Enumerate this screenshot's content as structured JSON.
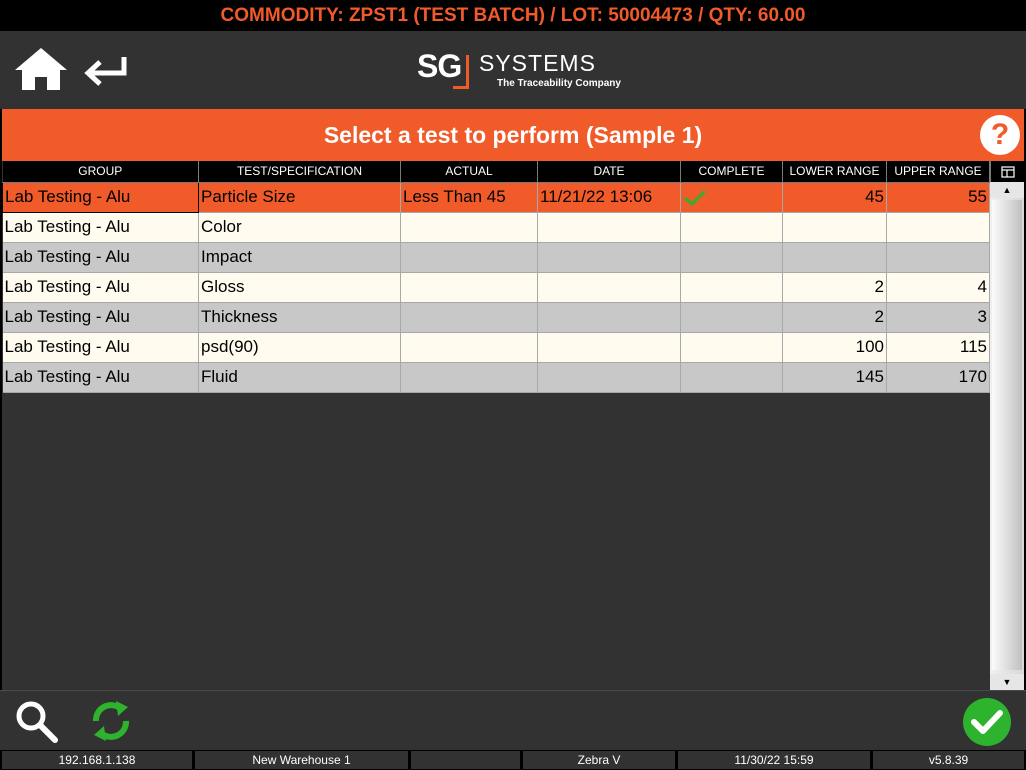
{
  "top_bar": {
    "text": "COMMODITY: ZPST1 (TEST BATCH) / LOT: 50004473 / QTY: 60.00"
  },
  "logo": {
    "sg": "SG",
    "systems": "SYSTEMS",
    "tagline": "The Traceability Company"
  },
  "title_bar": {
    "title": "Select a test to perform (Sample 1)",
    "help": "?"
  },
  "table": {
    "headers": [
      "GROUP",
      "TEST/SPECIFICATION",
      "ACTUAL",
      "DATE",
      "COMPLETE",
      "LOWER RANGE",
      "UPPER RANGE"
    ],
    "rows": [
      {
        "group": "Lab Testing - Alu",
        "test": "Particle Size",
        "actual": "Less Than 45",
        "date": "11/21/22 13:06",
        "complete": true,
        "lower": "45",
        "upper": "55"
      },
      {
        "group": "Lab Testing - Alu",
        "test": "Color",
        "actual": "",
        "date": "",
        "complete": false,
        "lower": "",
        "upper": ""
      },
      {
        "group": "Lab Testing - Alu",
        "test": "Impact",
        "actual": "",
        "date": "",
        "complete": false,
        "lower": "",
        "upper": ""
      },
      {
        "group": "Lab Testing - Alu",
        "test": "Gloss",
        "actual": "",
        "date": "",
        "complete": false,
        "lower": "2",
        "upper": "4"
      },
      {
        "group": "Lab Testing - Alu",
        "test": "Thickness",
        "actual": "",
        "date": "",
        "complete": false,
        "lower": "2",
        "upper": "3"
      },
      {
        "group": "Lab Testing - Alu",
        "test": "psd(90)",
        "actual": "",
        "date": "",
        "complete": false,
        "lower": "100",
        "upper": "115"
      },
      {
        "group": "Lab Testing - Alu",
        "test": "Fluid",
        "actual": "",
        "date": "",
        "complete": false,
        "lower": "145",
        "upper": "170"
      }
    ]
  },
  "status_bar": {
    "ip": "192.168.1.138",
    "warehouse": "New Warehouse 1",
    "empty": "",
    "printer": "Zebra V",
    "datetime": "11/30/22 15:59",
    "version": "v5.8.39"
  },
  "colors": {
    "accent": "#f15a29",
    "confirm": "#2db32d",
    "refresh": "#2db32d",
    "dark_bg": "#323232"
  },
  "icons": {
    "home": "home-icon",
    "back": "back-arrow-icon",
    "help": "help-icon",
    "search": "search-icon",
    "refresh": "refresh-icon",
    "confirm": "checkmark-icon",
    "columns": "column-chooser-icon",
    "scroll_up": "arrow-up-icon",
    "scroll_down": "arrow-down-icon"
  }
}
